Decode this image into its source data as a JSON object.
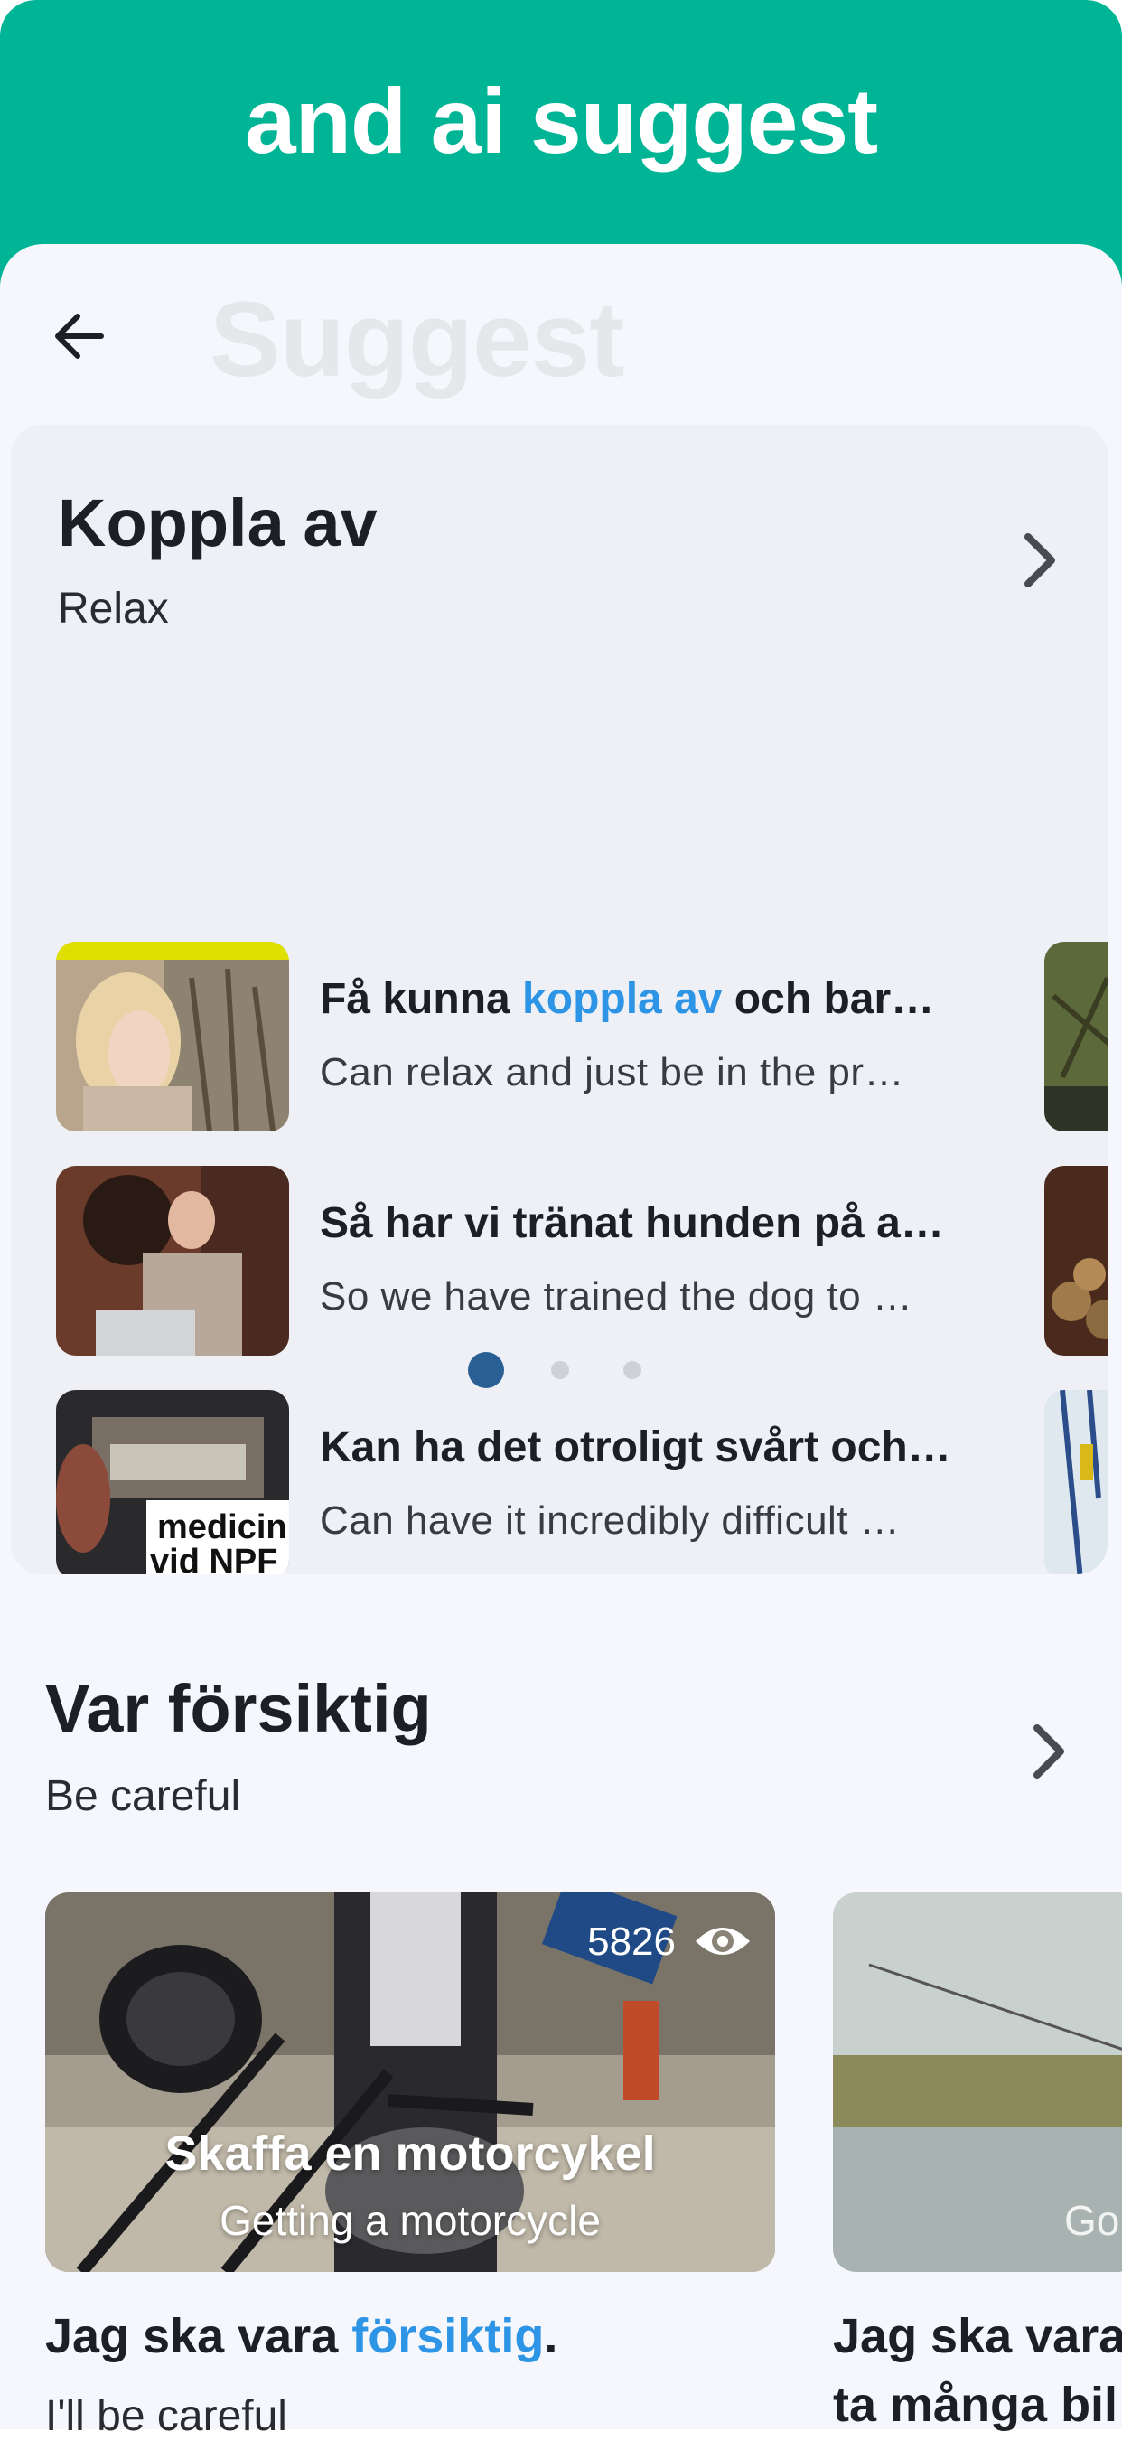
{
  "header": {
    "title": "and ai suggest"
  },
  "screen": {
    "ghost_title": "Suggest"
  },
  "relax_section": {
    "title": "Koppla av",
    "subtitle": "Relax",
    "items": [
      {
        "title_pre": "Få kunna ",
        "title_hl": "koppla av",
        "title_post": " och bara…",
        "subtitle": "Can relax and just be in the pre…"
      },
      {
        "title": "Så har vi tränat hunden på at…",
        "subtitle": "So we have trained the dog to r…"
      },
      {
        "title": "Kan ha det otroligt svårt och …",
        "subtitle": "Can have it incredibly difficult a…"
      }
    ],
    "thumb3_text": [
      "medicin",
      "vid NPF"
    ],
    "pagination": {
      "pages": 3,
      "active": 1
    },
    "colors": {
      "active_dot": "#2a5f94",
      "inactive_dot": "#cfd1d6",
      "highlight": "#2e95e6"
    }
  },
  "careful_section": {
    "title": "Var försiktig",
    "subtitle": "Be careful",
    "cards": [
      {
        "views": "5826",
        "title": "Skaffa en motorcykel",
        "subtitle": "Getting a motorcycle",
        "caption_pre": "Jag ska vara ",
        "caption_hl": "försiktig",
        "caption_post": ".",
        "caption_sub": "I'll be careful"
      },
      {
        "overlay_sub": "Go",
        "caption_line1": "Jag ska vara",
        "caption_line2": "ta många bil"
      }
    ]
  },
  "icons": {
    "back": "arrow-left-icon",
    "chevron": "chevron-right-icon",
    "views": "eye-icon"
  },
  "colors": {
    "header": "#00b496",
    "sheet": "#f5f7fc",
    "card": "#eef0f6"
  }
}
